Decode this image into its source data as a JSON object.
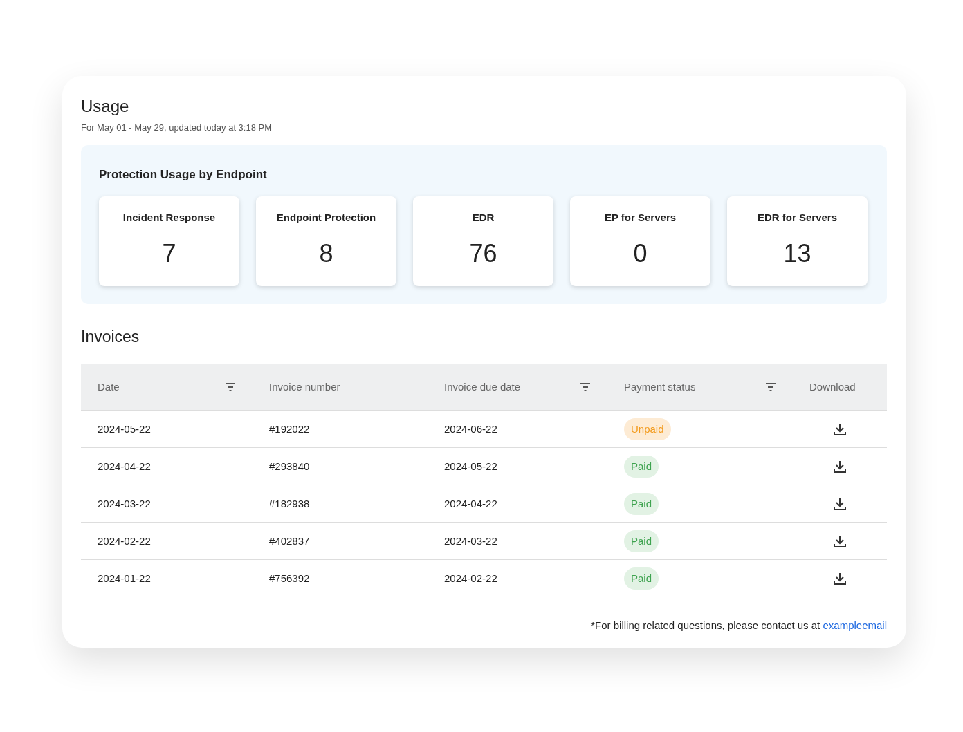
{
  "usage": {
    "title": "Usage",
    "subtitle": "For May 01 - May 29, updated today at 3:18 PM"
  },
  "protection": {
    "title": "Protection Usage by Endpoint",
    "tiles": [
      {
        "label": "Incident Response",
        "value": "7"
      },
      {
        "label": "Endpoint Protection",
        "value": "8"
      },
      {
        "label": "EDR",
        "value": "76"
      },
      {
        "label": "EP for Servers",
        "value": "0"
      },
      {
        "label": "EDR for Servers",
        "value": "13"
      }
    ]
  },
  "invoices": {
    "title": "Invoices",
    "columns": [
      {
        "label": "Date",
        "filterable": true
      },
      {
        "label": "Invoice number",
        "filterable": false
      },
      {
        "label": "Invoice due date",
        "filterable": true
      },
      {
        "label": "Payment status",
        "filterable": true
      },
      {
        "label": "Download",
        "filterable": false
      }
    ],
    "rows": [
      {
        "date": "2024-05-22",
        "number": "#192022",
        "due": "2024-06-22",
        "status": {
          "label": "Unpaid",
          "kind": "unpaid"
        }
      },
      {
        "date": "2024-04-22",
        "number": "#293840",
        "due": "2024-05-22",
        "status": {
          "label": "Paid",
          "kind": "paid"
        }
      },
      {
        "date": "2024-03-22",
        "number": "#182938",
        "due": "2024-04-22",
        "status": {
          "label": "Paid",
          "kind": "paid"
        }
      },
      {
        "date": "2024-02-22",
        "number": "#402837",
        "due": "2024-03-22",
        "status": {
          "label": "Paid",
          "kind": "paid"
        }
      },
      {
        "date": "2024-01-22",
        "number": "#756392",
        "due": "2024-02-22",
        "status": {
          "label": "Paid",
          "kind": "paid"
        }
      }
    ]
  },
  "footer": {
    "note": "*For billing related questions, please contact us at",
    "link": "exampleemail"
  }
}
